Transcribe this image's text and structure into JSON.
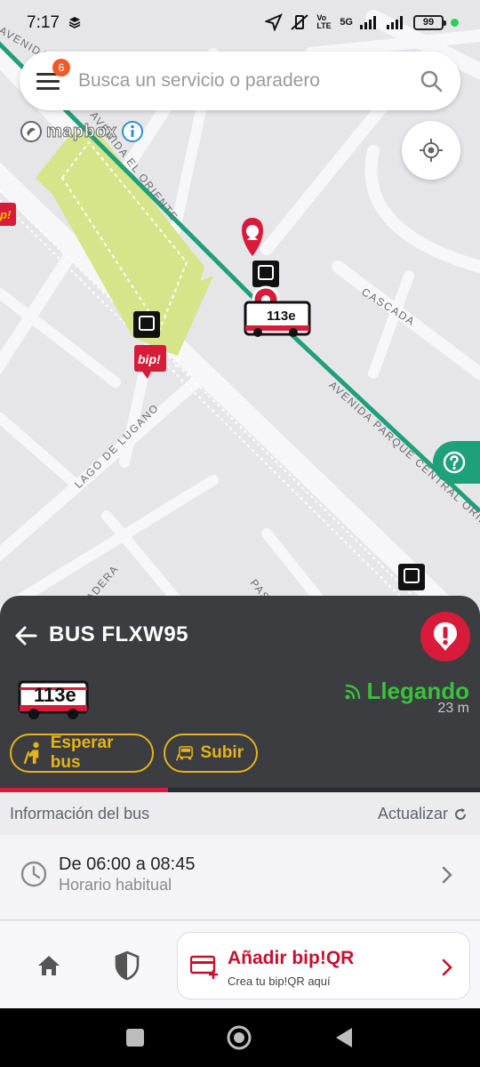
{
  "status_bar": {
    "time": "7:17",
    "network": "5G",
    "volte": "Vo LTE",
    "battery": "99"
  },
  "search": {
    "placeholder": "Busca un servicio o paradero",
    "notification_count": "6"
  },
  "map": {
    "attribution": "mapbox",
    "street_labels": [
      "AVENIDA",
      "AVENIDA EL ORIENTE",
      "CASCADA",
      "AVENIDA PARQUE CENTRAL ORIENTE",
      "LAGO DE LUGANO",
      "PADERA",
      "PASA"
    ],
    "bus_marker_label": "113e",
    "bip_label": "bip!",
    "colors": {
      "route": "#1ea07a",
      "park": "#d6e48a",
      "accent": "#d81b3a"
    }
  },
  "bus_panel": {
    "title": "BUS FLXW95",
    "route": "113e",
    "arrival_status": "Llegando",
    "distance": "23 m",
    "wait_button": "Esperar bus",
    "board_button": "Subir",
    "progress": 0.35
  },
  "info": {
    "section_label": "Información del bus",
    "refresh_label": "Actualizar",
    "schedule_main": "De 06:00 a 08:45",
    "schedule_sub": "Horario habitual"
  },
  "bottom_nav": {
    "bip_title": "Añadir bip!QR",
    "bip_subtitle": "Crea tu bip!QR aquí"
  }
}
